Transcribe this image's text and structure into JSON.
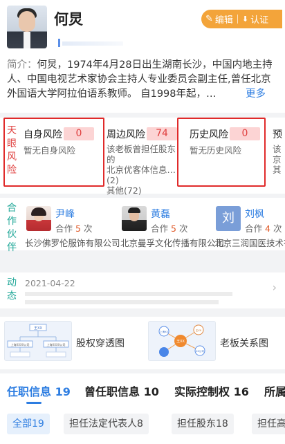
{
  "person": {
    "name": "何炅",
    "edit_label": "编辑",
    "claim_label": "认证"
  },
  "intro": {
    "label": "简介：",
    "text": "何炅，1974年4月28日出生湖南长沙，中国内地主持人、中国电视艺术家协会主持人专业委员会副主任,曾任北京外国语大学阿拉伯语系教师。 自1998年起，…",
    "more": "更多"
  },
  "risk": {
    "side_label": [
      "天",
      "眼",
      "风",
      "险"
    ],
    "columns": [
      {
        "title": "自身风险",
        "count": "0",
        "desc": [
          "暂无自身风险"
        ]
      },
      {
        "title": "周边风险",
        "count": "74",
        "desc": [
          "该老板曾担任股东的",
          "北京优客体信息…(2)",
          "其他(72)"
        ]
      },
      {
        "title": "历史风险",
        "count": "0",
        "desc": [
          "暂无历史风险"
        ]
      },
      {
        "title": "预",
        "count": "",
        "desc": [
          "该",
          "京",
          "其"
        ]
      }
    ]
  },
  "partners": {
    "side_label": [
      "合",
      "作",
      "伙",
      "伴"
    ],
    "count_prefix": "合作",
    "count_suffix": "次",
    "items": [
      {
        "name": "尹峰",
        "count": "5",
        "company": "长沙佛罗伦服饰有限公司"
      },
      {
        "name": "黄磊",
        "count": "5",
        "company": "北京曼孚文化传播有限公司"
      },
      {
        "name": "刘枫",
        "avatar_char": "刘",
        "count": "4",
        "company": "北京三润国医技术有"
      }
    ]
  },
  "dynamics": {
    "side_label": [
      "动",
      "态"
    ],
    "date": "2021-04-22"
  },
  "graphs": {
    "equity_label": "股权穿透图",
    "relation_label": "老板关系图",
    "equity_thumb": {
      "root": "王XX",
      "left": "上海XXXX公司",
      "right": "上海XXXX公司"
    },
    "relation_thumb": {
      "center": "王XX",
      "n1": "上海XX",
      "n2": "王XX",
      "n3": "XX公司"
    }
  },
  "tabs": [
    {
      "label": "任职信息",
      "count": "19"
    },
    {
      "label": "曾任职信息",
      "count": "10"
    },
    {
      "label": "实际控制权",
      "count": "16"
    },
    {
      "label": "所属",
      "count": ""
    }
  ],
  "chips": [
    "全部19",
    "担任法定代表人8",
    "担任股东18",
    "担任高"
  ],
  "colors": {
    "accent": "#2d7de1",
    "risk_red": "#e02a2a",
    "orange": "#f3a43a",
    "teal": "#24a99a"
  }
}
